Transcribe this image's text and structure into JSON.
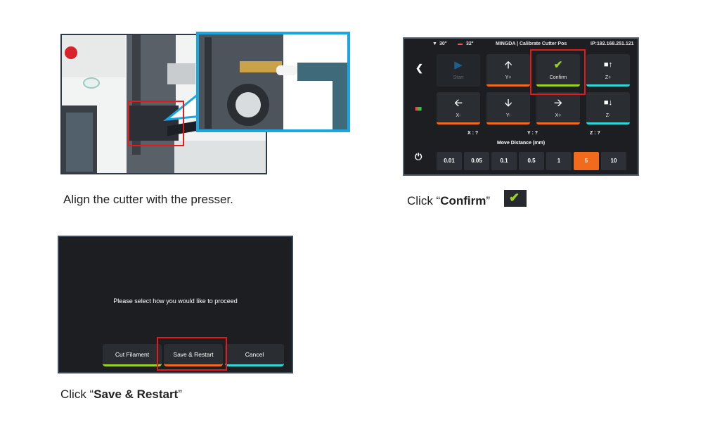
{
  "step1": {
    "caption": "Align the cutter with the presser."
  },
  "step2": {
    "caption_prefix": "Click “",
    "caption_bold": "Confirm",
    "caption_suffix": "”",
    "screen": {
      "nozzle_temp": "30°",
      "bed_temp": "32°",
      "title": "MINGDA  | Calibrate Cutter Pos",
      "ip": "IP:192.168.251.121",
      "tiles": {
        "start": "Start",
        "y_plus": "Y+",
        "confirm": "Confirm",
        "z_plus": "Z+",
        "x_minus": "X-",
        "y_minus": "Y-",
        "x_plus": "X+",
        "z_minus": "Z-"
      },
      "axis": {
        "x": "X : ?",
        "y": "Y : ?",
        "z": "Z : ?"
      },
      "move_distance_label": "Move Distance (mm)",
      "distances": [
        "0.01",
        "0.05",
        "0.1",
        "0.5",
        "1",
        "5",
        "10"
      ],
      "selected_distance": "5",
      "accent_colors": {
        "orange": "#f26b1d",
        "green": "#9bd21e",
        "cyan": "#2fd6d6"
      }
    }
  },
  "step3": {
    "caption_prefix": "Click “",
    "caption_bold": "Save & Restart",
    "caption_suffix": "”",
    "screen": {
      "prompt": "Please select how you would like to proceed",
      "buttons": {
        "cut": "Cut Filament",
        "save": "Save & Restart",
        "cancel": "Cancel"
      }
    }
  },
  "highlight_color": "#e51b1b"
}
